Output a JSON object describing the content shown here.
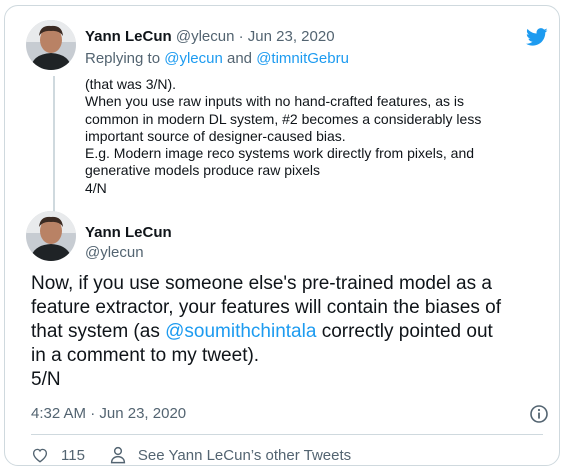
{
  "parent": {
    "name": "Yann LeCun",
    "handle": "@ylecun",
    "separator": "·",
    "date": "Jun 23, 2020",
    "replying_prefix": "Replying to",
    "replying_user1": "@ylecun",
    "replying_and": "and",
    "replying_user2": "@timnitGebru",
    "lines": [
      "(that was 3/N).",
      "When you use raw inputs with no hand-crafted features, as is",
      "common in modern DL system, #2 becomes a considerably less",
      "important source of designer-caused bias.",
      "E.g. Modern image reco systems work directly from pixels, and",
      "generative models produce raw pixels",
      "4/N"
    ]
  },
  "tweet": {
    "name": "Yann LeCun",
    "handle": "@ylecun",
    "line1": "Now, if you use someone else's pre-trained model as a",
    "line2": "feature extractor, your features will contain the biases of",
    "line3_before": "that system (as ",
    "line3_mention": "@soumithchintala",
    "line3_after": " correctly pointed out",
    "line4": "in a comment to my tweet).",
    "line5": "5/N",
    "time": "4:32 AM",
    "date": "Jun 23, 2020",
    "separator": "·"
  },
  "actions": {
    "like_count": "115",
    "other_tweets": "See Yann LeCun’s other Tweets"
  },
  "colors": {
    "accent": "#1d9bf0",
    "text": "#0f1419",
    "muted": "#536471",
    "border": "#cfd9de"
  },
  "icons": [
    "twitter-bird-icon",
    "info-icon",
    "heart-icon",
    "person-icon"
  ]
}
